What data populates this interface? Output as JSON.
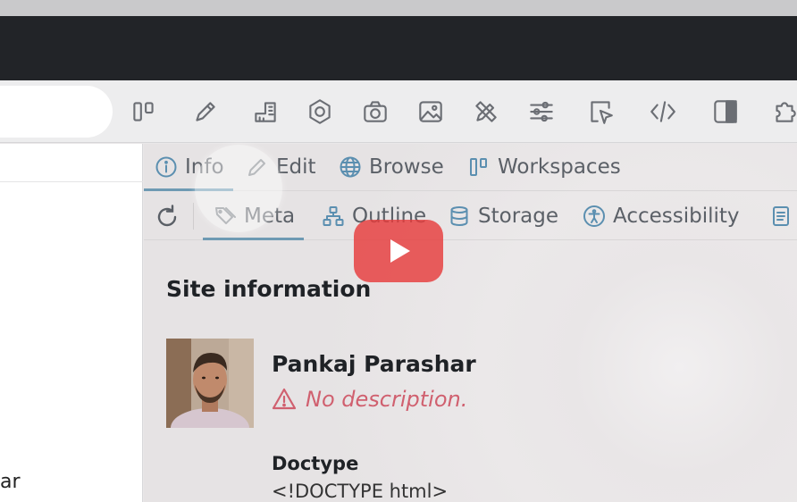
{
  "toolbar": {
    "icons": [
      "workspaces-icon",
      "pencil-icon",
      "ruler-icon",
      "hexagon-icon",
      "camera-icon",
      "image-icon",
      "tools-icon",
      "sliders-icon",
      "select-cursor-icon",
      "code-icon",
      "sidebar-icon",
      "puzzle-icon"
    ]
  },
  "left_pane": {
    "text_fragment": "ar"
  },
  "tabs_primary": [
    {
      "label": "Info",
      "icon": "info-icon",
      "active": true
    },
    {
      "label": "Edit",
      "icon": "pencil-icon",
      "active": false
    },
    {
      "label": "Browse",
      "icon": "globe-icon",
      "active": false
    },
    {
      "label": "Workspaces",
      "icon": "workspaces-icon",
      "active": false
    }
  ],
  "tabs_secondary": [
    {
      "label": "Meta",
      "icon": "tags-icon",
      "active": true
    },
    {
      "label": "Outline",
      "icon": "outline-tree-icon",
      "active": false
    },
    {
      "label": "Storage",
      "icon": "database-icon",
      "active": false
    },
    {
      "label": "Accessibility",
      "icon": "accessibility-icon",
      "active": false
    }
  ],
  "content": {
    "section_title": "Site information",
    "site_name": "Pankaj Parashar",
    "description_warning": "No description.",
    "doctype_label": "Doctype",
    "doctype_value": "<!DOCTYPE html>"
  },
  "colors": {
    "accent": "#6e9ab3",
    "warning": "#d0606f",
    "play_button": "#e63c3c"
  }
}
